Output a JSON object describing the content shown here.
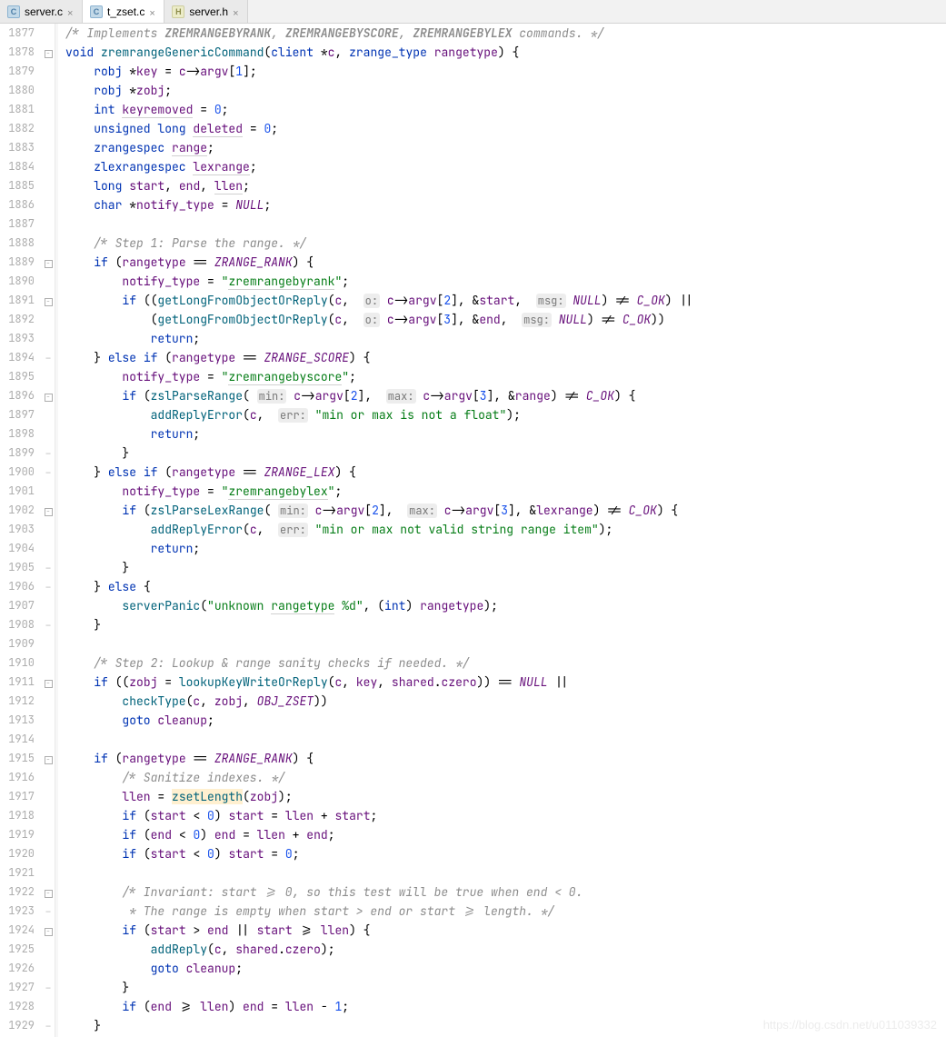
{
  "tabs": [
    {
      "name": "server.c",
      "active": false,
      "iconType": "c"
    },
    {
      "name": "t_zset.c",
      "active": true,
      "iconType": "c"
    },
    {
      "name": "server.h",
      "active": false,
      "iconType": "h"
    }
  ],
  "startLine": 1877,
  "endLine": 1929,
  "watermark": "https://blog.csdn.net/u011039332",
  "code": [
    {
      "n": 1877,
      "html": "<span class='cmt'>/* Implements <span class='doc-b'>ZREMRANGEBYRANK</span>, <span class='doc-b'>ZREMRANGEBYSCORE</span>, <span class='doc-b'>ZREMRANGEBYLEX</span> commands. */</span>"
    },
    {
      "n": 1878,
      "fold": "box",
      "html": "<span class='kw'>void</span> <span class='fn-def'>zremrangeGenericCommand</span>(<span class='type'>client</span> *<span class='var'>c</span>, <span class='type'>zrange_type</span> <span class='var'>rangetype</span>) {"
    },
    {
      "n": 1879,
      "html": "    <span class='type'>robj</span> *<span class='var'>key</span> = <span class='var'>c</span>-&gt;<span class='var'>argv</span>[<span class='num'>1</span>];"
    },
    {
      "n": 1880,
      "html": "    <span class='type'>robj</span> *<span class='var'>zobj</span>;"
    },
    {
      "n": 1881,
      "html": "    <span class='kw'>int</span> <span class='var underline-w'>keyremoved</span> = <span class='num'>0</span>;"
    },
    {
      "n": 1882,
      "html": "    <span class='kw'>unsigned long</span> <span class='var underline-w'>deleted</span> = <span class='num'>0</span>;"
    },
    {
      "n": 1883,
      "html": "    <span class='type'>zrangespec</span> <span class='var underline-w'>range</span>;"
    },
    {
      "n": 1884,
      "html": "    <span class='type'>zlexrangespec</span> <span class='var underline-w'>lexrange</span>;"
    },
    {
      "n": 1885,
      "html": "    <span class='kw'>long</span> <span class='var'>start</span>, <span class='var'>end</span>, <span class='var underline-w'>llen</span>;"
    },
    {
      "n": 1886,
      "html": "    <span class='kw'>char</span> *<span class='var'>notify_type</span> = <span class='macro'>NULL</span>;"
    },
    {
      "n": 1887,
      "html": ""
    },
    {
      "n": 1888,
      "html": "    <span class='cmt'>/* Step 1: Parse the range. */</span>"
    },
    {
      "n": 1889,
      "fold": "box",
      "html": "    <span class='kw'>if</span> (<span class='var'>rangetype</span> == <span class='macro'>ZRANGE_RANK</span>) {"
    },
    {
      "n": 1890,
      "html": "        <span class='var'>notify_type</span> = <span class='str'>\"<span class='underline-w'>zremrangebyrank</span>\"</span>;"
    },
    {
      "n": 1891,
      "fold": "box",
      "html": "        <span class='kw'>if</span> ((<span class='fn'>getLongFromObjectOrReply</span>(<span class='var'>c</span>,  <span class='param-hint'>o:</span> <span class='var'>c</span>-&gt;<span class='var'>argv</span>[<span class='num'>2</span>], &amp;<span class='var'>start</span>,  <span class='param-hint'>msg:</span> <span class='macro'>NULL</span>) != <span class='macro'>C_OK</span>) ||"
    },
    {
      "n": 1892,
      "html": "            (<span class='fn'>getLongFromObjectOrReply</span>(<span class='var'>c</span>,  <span class='param-hint'>o:</span> <span class='var'>c</span>-&gt;<span class='var'>argv</span>[<span class='num'>3</span>], &amp;<span class='var'>end</span>,  <span class='param-hint'>msg:</span> <span class='macro'>NULL</span>) != <span class='macro'>C_OK</span>))"
    },
    {
      "n": 1893,
      "html": "            <span class='kw'>return</span>;"
    },
    {
      "n": 1894,
      "fold": "end",
      "html": "    } <span class='kw'>else if</span> (<span class='var'>rangetype</span> == <span class='macro'>ZRANGE_SCORE</span>) {"
    },
    {
      "n": 1895,
      "html": "        <span class='var'>notify_type</span> = <span class='str'>\"<span class='underline-w'>zremrangebyscore</span>\"</span>;"
    },
    {
      "n": 1896,
      "fold": "box",
      "html": "        <span class='kw'>if</span> (<span class='fn'>zslParseRange</span>( <span class='param-hint'>min:</span> <span class='var'>c</span>-&gt;<span class='var'>argv</span>[<span class='num'>2</span>],  <span class='param-hint'>max:</span> <span class='var'>c</span>-&gt;<span class='var'>argv</span>[<span class='num'>3</span>], &amp;<span class='var'>range</span>) != <span class='macro'>C_OK</span>) {"
    },
    {
      "n": 1897,
      "html": "            <span class='fn'>addReplyError</span>(<span class='var'>c</span>,  <span class='param-hint'>err:</span> <span class='str'>\"min or max is not a float\"</span>);"
    },
    {
      "n": 1898,
      "html": "            <span class='kw'>return</span>;"
    },
    {
      "n": 1899,
      "fold": "end",
      "html": "        }"
    },
    {
      "n": 1900,
      "fold": "end",
      "html": "    } <span class='kw'>else if</span> (<span class='var'>rangetype</span> == <span class='macro'>ZRANGE_LEX</span>) {"
    },
    {
      "n": 1901,
      "html": "        <span class='var'>notify_type</span> = <span class='str'>\"<span class='underline-w'>zremrangebylex</span>\"</span>;"
    },
    {
      "n": 1902,
      "fold": "box",
      "html": "        <span class='kw'>if</span> (<span class='fn'>zslParseLexRange</span>( <span class='param-hint'>min:</span> <span class='var'>c</span>-&gt;<span class='var'>argv</span>[<span class='num'>2</span>],  <span class='param-hint'>max:</span> <span class='var'>c</span>-&gt;<span class='var'>argv</span>[<span class='num'>3</span>], &amp;<span class='var'>lexrange</span>) != <span class='macro'>C_OK</span>) {"
    },
    {
      "n": 1903,
      "html": "            <span class='fn'>addReplyError</span>(<span class='var'>c</span>,  <span class='param-hint'>err:</span> <span class='str'>\"min or max not valid string range item\"</span>);"
    },
    {
      "n": 1904,
      "html": "            <span class='kw'>return</span>;"
    },
    {
      "n": 1905,
      "fold": "end",
      "html": "        }"
    },
    {
      "n": 1906,
      "fold": "end",
      "html": "    } <span class='kw'>else</span> {"
    },
    {
      "n": 1907,
      "html": "        <span class='fn'>serverPanic</span>(<span class='str'>\"unknown <span class='underline-w'>rangetype</span> %d\"</span>, (<span class='kw'>int</span>) <span class='var'>rangetype</span>);"
    },
    {
      "n": 1908,
      "fold": "end",
      "html": "    }"
    },
    {
      "n": 1909,
      "html": ""
    },
    {
      "n": 1910,
      "html": "    <span class='cmt'>/* Step 2: Lookup &amp; range sanity checks if needed. */</span>"
    },
    {
      "n": 1911,
      "fold": "box",
      "html": "    <span class='kw'>if</span> ((<span class='var'>zobj</span> = <span class='fn'>lookupKeyWriteOrReply</span>(<span class='var'>c</span>, <span class='var'>key</span>, <span class='var'>shared</span>.<span class='var'>czero</span>)) == <span class='macro'>NULL</span> ||"
    },
    {
      "n": 1912,
      "html": "        <span class='fn'>checkType</span>(<span class='var'>c</span>, <span class='var'>zobj</span>, <span class='macro'>OBJ_ZSET</span>))"
    },
    {
      "n": 1913,
      "html": "        <span class='kw'>goto</span> <span class='var'>cleanup</span>;"
    },
    {
      "n": 1914,
      "html": ""
    },
    {
      "n": 1915,
      "fold": "box",
      "html": "    <span class='kw'>if</span> (<span class='var'>rangetype</span> == <span class='macro'>ZRANGE_RANK</span>) {"
    },
    {
      "n": 1916,
      "html": "        <span class='cmt'>/* Sanitize indexes. */</span>"
    },
    {
      "n": 1917,
      "html": "        <span class='var'>llen</span> = <span class='fn highlight-y'>zsetLength</span>(<span class='var'>zobj</span>);"
    },
    {
      "n": 1918,
      "html": "        <span class='kw'>if</span> (<span class='var'>start</span> &lt; <span class='num'>0</span>) <span class='var'>start</span> = <span class='var'>llen</span> + <span class='var'>start</span>;"
    },
    {
      "n": 1919,
      "html": "        <span class='kw'>if</span> (<span class='var'>end</span> &lt; <span class='num'>0</span>) <span class='var'>end</span> = <span class='var'>llen</span> + <span class='var'>end</span>;"
    },
    {
      "n": 1920,
      "html": "        <span class='kw'>if</span> (<span class='var'>start</span> &lt; <span class='num'>0</span>) <span class='var'>start</span> = <span class='num'>0</span>;"
    },
    {
      "n": 1921,
      "html": ""
    },
    {
      "n": 1922,
      "fold": "box",
      "html": "        <span class='cmt'>/* Invariant: start &gt;= 0, so this test will be true when end &lt; 0.</span>"
    },
    {
      "n": 1923,
      "fold": "end",
      "html": "<span class='cmt'>         * The range is empty when start &gt; end or start &gt;= length. */</span>"
    },
    {
      "n": 1924,
      "fold": "box",
      "html": "        <span class='kw'>if</span> (<span class='var'>start</span> &gt; <span class='var'>end</span> || <span class='var'>start</span> &gt;= <span class='var'>llen</span>) {"
    },
    {
      "n": 1925,
      "html": "            <span class='fn'>addReply</span>(<span class='var'>c</span>, <span class='var'>shared</span>.<span class='var'>czero</span>);"
    },
    {
      "n": 1926,
      "html": "            <span class='kw'>goto</span> <span class='var'>cleanup</span>;"
    },
    {
      "n": 1927,
      "fold": "end",
      "html": "        }"
    },
    {
      "n": 1928,
      "html": "        <span class='kw'>if</span> (<span class='var'>end</span> &gt;= <span class='var'>llen</span>) <span class='var'>end</span> = <span class='var'>llen</span> - <span class='num'>1</span>;"
    },
    {
      "n": 1929,
      "fold": "end",
      "html": "    }"
    }
  ]
}
